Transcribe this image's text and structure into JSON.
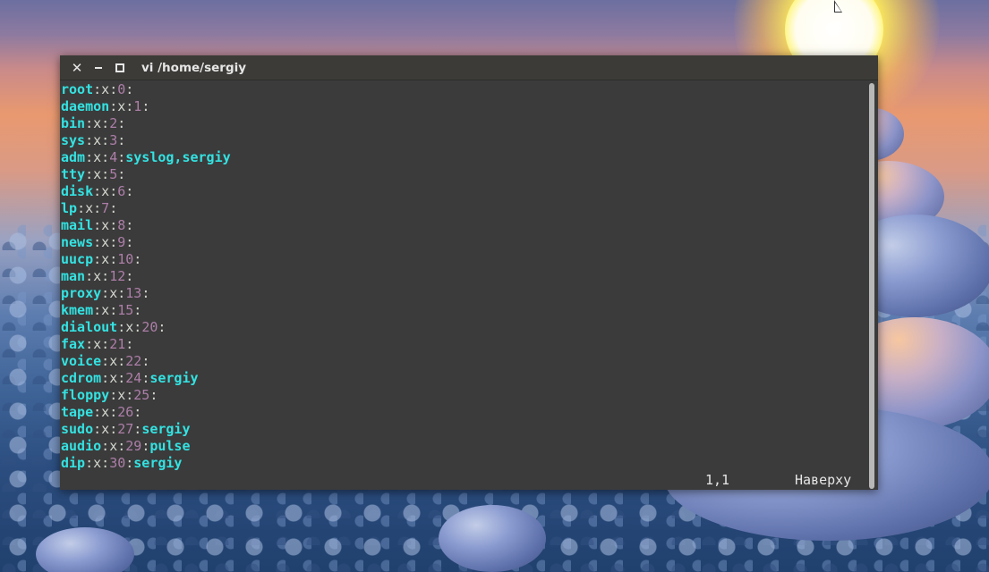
{
  "window": {
    "title": "vi  /home/sergiy",
    "controls": [
      "close-icon",
      "minimize-icon",
      "maximize-icon"
    ]
  },
  "groups": [
    {
      "name": "root",
      "pw": "x",
      "gid": "0",
      "members": ""
    },
    {
      "name": "daemon",
      "pw": "x",
      "gid": "1",
      "members": ""
    },
    {
      "name": "bin",
      "pw": "x",
      "gid": "2",
      "members": ""
    },
    {
      "name": "sys",
      "pw": "x",
      "gid": "3",
      "members": ""
    },
    {
      "name": "adm",
      "pw": "x",
      "gid": "4",
      "members": "syslog,sergiy"
    },
    {
      "name": "tty",
      "pw": "x",
      "gid": "5",
      "members": ""
    },
    {
      "name": "disk",
      "pw": "x",
      "gid": "6",
      "members": ""
    },
    {
      "name": "lp",
      "pw": "x",
      "gid": "7",
      "members": ""
    },
    {
      "name": "mail",
      "pw": "x",
      "gid": "8",
      "members": ""
    },
    {
      "name": "news",
      "pw": "x",
      "gid": "9",
      "members": ""
    },
    {
      "name": "uucp",
      "pw": "x",
      "gid": "10",
      "members": ""
    },
    {
      "name": "man",
      "pw": "x",
      "gid": "12",
      "members": ""
    },
    {
      "name": "proxy",
      "pw": "x",
      "gid": "13",
      "members": ""
    },
    {
      "name": "kmem",
      "pw": "x",
      "gid": "15",
      "members": ""
    },
    {
      "name": "dialout",
      "pw": "x",
      "gid": "20",
      "members": ""
    },
    {
      "name": "fax",
      "pw": "x",
      "gid": "21",
      "members": ""
    },
    {
      "name": "voice",
      "pw": "x",
      "gid": "22",
      "members": ""
    },
    {
      "name": "cdrom",
      "pw": "x",
      "gid": "24",
      "members": "sergiy"
    },
    {
      "name": "floppy",
      "pw": "x",
      "gid": "25",
      "members": ""
    },
    {
      "name": "tape",
      "pw": "x",
      "gid": "26",
      "members": ""
    },
    {
      "name": "sudo",
      "pw": "x",
      "gid": "27",
      "members": "sergiy"
    },
    {
      "name": "audio",
      "pw": "x",
      "gid": "29",
      "members": "pulse"
    },
    {
      "name": "dip",
      "pw": "x",
      "gid": "30",
      "members": "sergiy"
    }
  ],
  "status": {
    "cursor_position": "1,1",
    "scroll_position": "Наверху"
  },
  "colors": {
    "terminal_bg": "#3b3b3b",
    "name": "#34e2e2",
    "separator": "#d3d7cf",
    "gid": "#ad7fa8"
  }
}
